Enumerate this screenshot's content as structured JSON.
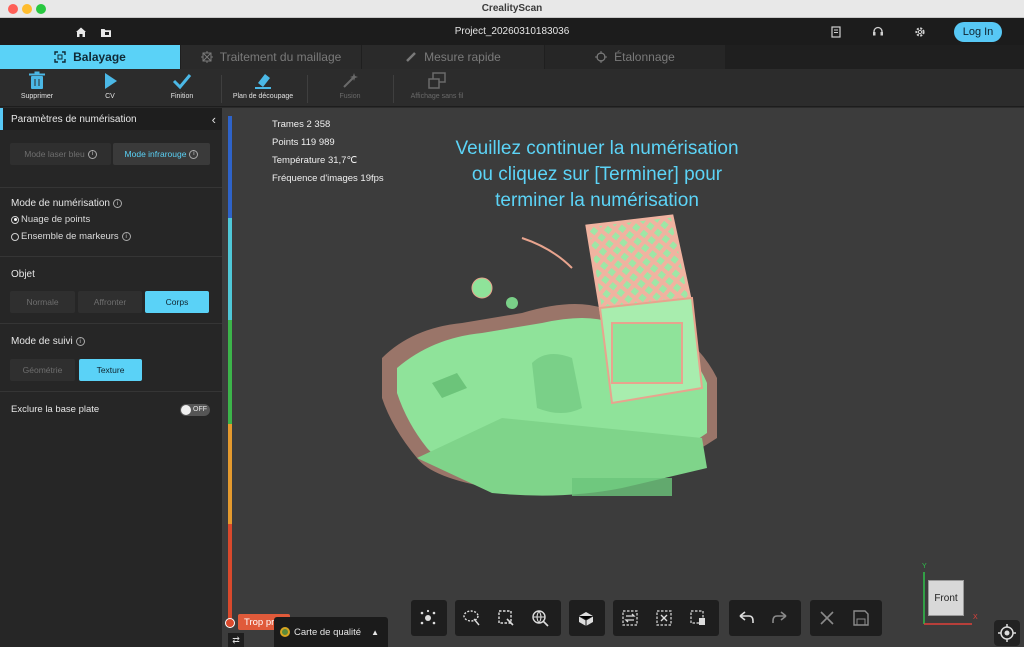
{
  "window": {
    "title": "CrealityScan"
  },
  "appbar": {
    "project_name": "Project_20260310183036",
    "login_label": "Log In"
  },
  "tabs": [
    {
      "label": "Balayage",
      "active": true,
      "icon": "scan-frame-icon"
    },
    {
      "label": "Traitement du maillage",
      "active": false,
      "icon": "mesh-icon"
    },
    {
      "label": "Mesure rapide",
      "active": false,
      "icon": "ruler-icon"
    },
    {
      "label": "Étalonnage",
      "active": false,
      "icon": "target-icon"
    }
  ],
  "toolbar": {
    "delete_label": "Supprimer",
    "cv_label": "CV",
    "finish_label": "Finition",
    "cut_plane_label": "Plan de découpage",
    "fusion_label": "Fusion",
    "wireless_display_label": "Affichage sans fil"
  },
  "panel": {
    "title": "Paramètres de numérisation",
    "laser_mode_label": "Mode laser bleu",
    "infrared_mode_label": "Mode infrarouge",
    "scan_mode_title": "Mode de numérisation",
    "scan_mode_options": [
      "Nuage de points",
      "Ensemble de markeurs"
    ],
    "scan_mode_selected": "Nuage de points",
    "object_title": "Objet",
    "object_options": [
      "Normale",
      "Affronter",
      "Corps"
    ],
    "object_selected": "Corps",
    "tracking_title": "Mode de suivi",
    "tracking_options": [
      "Géométrie",
      "Texture"
    ],
    "tracking_selected": "Texture",
    "base_plate_label": "Exclure la base plate",
    "base_plate_toggle": "OFF"
  },
  "viewport": {
    "stats": {
      "frames": "Trames 2 358",
      "points": "Points 119 989",
      "temperature": "Température 31,7℃",
      "fps": "Fréquence d'images 19fps"
    },
    "message_lines": [
      "Veuillez continuer la numérisation",
      "ou cliquez sur [Terminer] pour",
      "terminer la numérisation"
    ],
    "distance_status": "Trop près",
    "quality_map_label": "Carte de qualité",
    "orientation_label": "Front",
    "axis_labels": {
      "x": "X",
      "y": "Y"
    }
  },
  "colors": {
    "accent": "#5ad2f7",
    "warning": "#e05a3a",
    "mesh_green": "#8fe39a",
    "mesh_pink": "#e8a48e"
  }
}
